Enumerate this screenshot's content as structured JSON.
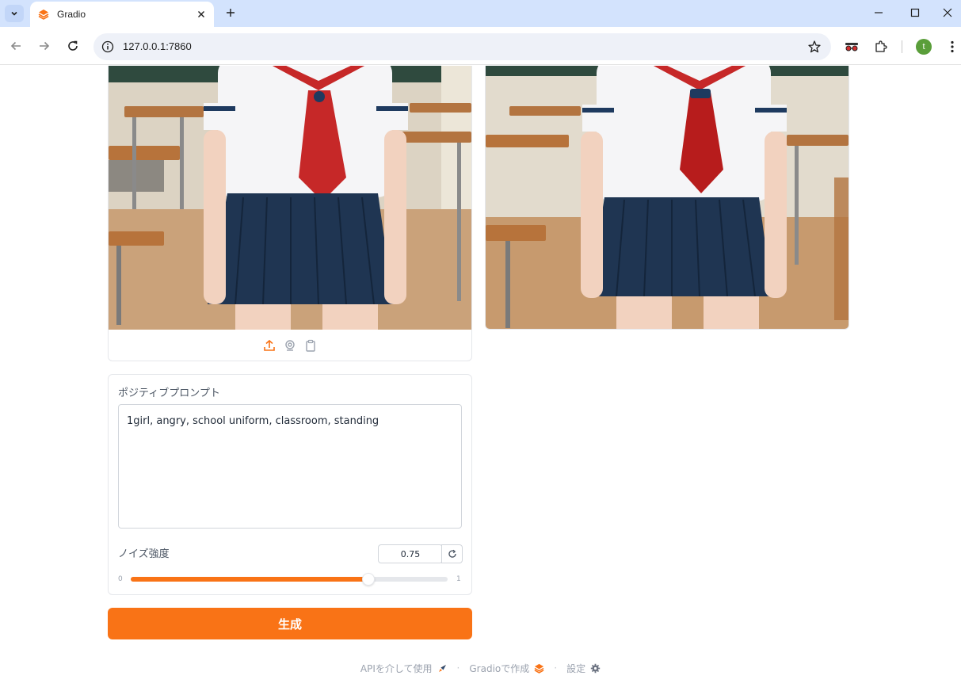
{
  "browser": {
    "tab_title": "Gradio",
    "url": "127.0.0.1:7860",
    "avatar_letter": "t",
    "icons": [
      "tab-search-icon",
      "gradio-favicon-icon",
      "close-icon",
      "plus-icon",
      "minimize-icon",
      "maximize-icon",
      "window-close-icon",
      "back-icon",
      "forward-icon",
      "reload-icon",
      "info-icon",
      "star-icon",
      "incognito-icon",
      "extensions-icon",
      "more-icon"
    ]
  },
  "image_input": {
    "toolbar_icons": [
      "upload-icon",
      "webcam-icon",
      "clipboard-icon"
    ]
  },
  "prompt": {
    "label": "ポジティブプロンプト",
    "value": "1girl, angry, school uniform, classroom, standing"
  },
  "noise": {
    "label": "ノイズ強度",
    "value": "0.75",
    "fraction": 0.75,
    "min": "0",
    "max": "1"
  },
  "generate_label": "生成",
  "footer": {
    "api": "APIを介して使用",
    "built_with": "Gradioで作成",
    "settings": "設定"
  },
  "colors": {
    "accent": "#f97316",
    "tabbar": "#d3e3fd"
  }
}
